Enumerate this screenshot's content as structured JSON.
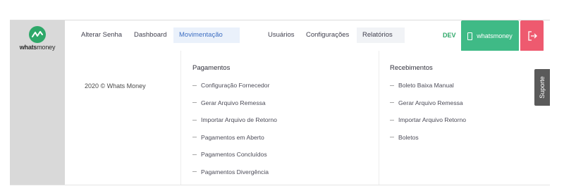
{
  "brand": {
    "logo_text_bold": "whats",
    "logo_text_light": "money"
  },
  "nav": {
    "items": [
      {
        "label": "Alterar Senha"
      },
      {
        "label": "Dashboard"
      },
      {
        "label": "Movimentação"
      },
      {
        "label": "Usuários"
      },
      {
        "label": "Configurações"
      },
      {
        "label": "Relatórios"
      }
    ],
    "active_item": "Movimentação",
    "env_tag": "DEV",
    "whatsmoney_button": "whatsmoney"
  },
  "footer": {
    "copyright": "2020 © Whats Money"
  },
  "dropdown": {
    "pagamentos": {
      "heading": "Pagamentos",
      "items": [
        "Configuração Fornecedor",
        "Gerar Arquivo Remessa",
        "Importar Arquivo de Retorno",
        "Pagamentos em Aberto",
        "Pagamentos Concluídos",
        "Pagamentos Divergência"
      ]
    },
    "recebimentos": {
      "heading": "Recebimentos",
      "items": [
        "Boleto Baixa Manual",
        "Gerar Arquivo Remessa",
        "Importar Arquivo Retorno",
        "Boletos"
      ]
    }
  },
  "support": {
    "label": "Suporte"
  },
  "colors": {
    "brand_green": "#2ea869",
    "whatsmoney_button": "#3fba86",
    "logout_button": "#ee5a6f",
    "active_nav_bg": "#eaf1fb",
    "active_nav_text": "#3d6ec2",
    "sidebar_bg": "#d9d9d9",
    "support_tab_bg": "#5a5a5a"
  },
  "icons": {
    "logo": "whatsmoney-logo-icon",
    "whatsmoney_button": "phone-icon",
    "logout": "logout-icon"
  }
}
